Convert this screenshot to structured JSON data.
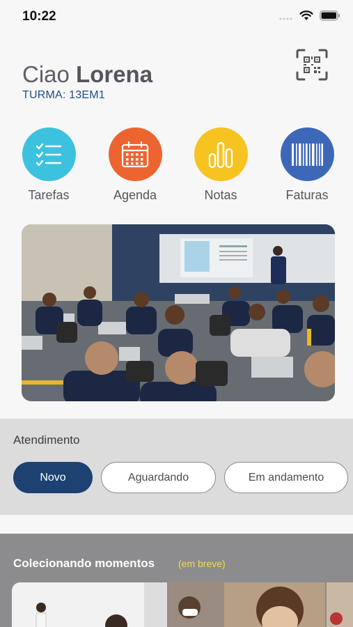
{
  "status_bar": {
    "time": "10:22"
  },
  "header": {
    "greeting_prefix": "Ciao",
    "user_name": "Lorena",
    "class_label": "TURMA: 13EM1"
  },
  "shortcuts": [
    {
      "label": "Tarefas",
      "icon": "checklist-icon",
      "color": "#3cc2de"
    },
    {
      "label": "Agenda",
      "icon": "calendar-icon",
      "color": "#ee6431"
    },
    {
      "label": "Notas",
      "icon": "bar-chart-icon",
      "color": "#f7c321"
    },
    {
      "label": "Faturas",
      "icon": "barcode-icon",
      "color": "#3d68b8"
    }
  ],
  "attendance": {
    "title": "Atendimento",
    "tabs": [
      {
        "label": "Novo",
        "active": true
      },
      {
        "label": "Aguardando",
        "active": false
      },
      {
        "label": "Em andamento",
        "active": false
      }
    ]
  },
  "moments": {
    "title": "Colecionando momentos",
    "badge": "(em breve)"
  },
  "colors": {
    "accent": "#1d4272",
    "class_label": "#1f4f86",
    "badge": "#f2dc4a"
  }
}
